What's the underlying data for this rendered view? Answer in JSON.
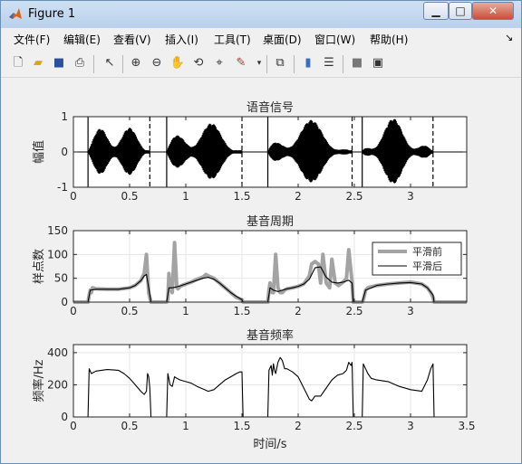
{
  "window": {
    "title": "Figure 1"
  },
  "menu": [
    "文件(F)",
    "编辑(E)",
    "查看(V)",
    "插入(I)",
    "工具(T)",
    "桌面(D)",
    "窗口(W)",
    "帮助(H)"
  ],
  "toolbar": [
    "new-figure",
    "open-file",
    "save",
    "print",
    "edit-pointer",
    "zoom-in",
    "zoom-out",
    "pan",
    "rotate-3d",
    "data-cursor",
    "brush",
    "link-plot",
    "colorbar",
    "legend",
    "hide-plot-tools",
    "show-plot-tools"
  ],
  "chart_data": [
    {
      "type": "line",
      "title": "语音信号",
      "ylabel": "幅值",
      "xlabel": "",
      "xlim": [
        0,
        3.5
      ],
      "ylim": [
        -1,
        1
      ],
      "xticks": [
        "0",
        "0.5",
        "1",
        "1.5",
        "2",
        "2.5",
        "3"
      ],
      "yticks": [
        "-1",
        "0",
        "1"
      ],
      "segments": [
        {
          "start": 0.13,
          "end": 0.68
        },
        {
          "start": 0.83,
          "end": 1.5
        },
        {
          "start": 1.73,
          "end": 2.48
        },
        {
          "start": 2.57,
          "end": 3.2
        }
      ],
      "solid_markers": [
        0.13,
        0.83,
        1.73,
        2.57
      ],
      "dashed_markers": [
        0.68,
        1.5,
        2.48,
        3.2
      ]
    },
    {
      "type": "line",
      "title": "基音周期",
      "ylabel": "样点数",
      "xlabel": "",
      "xlim": [
        0,
        3.5
      ],
      "ylim": [
        0,
        150
      ],
      "xticks": [
        "0",
        "0.5",
        "1",
        "1.5",
        "2",
        "2.5",
        "3"
      ],
      "yticks": [
        "0",
        "50",
        "100",
        "150"
      ],
      "legend": [
        "平滑前",
        "平滑后"
      ],
      "legend_position": "right",
      "series": [
        {
          "name": "平滑前",
          "x": [
            0,
            0.13,
            0.14,
            0.15,
            0.16,
            0.17,
            0.2,
            0.3,
            0.4,
            0.5,
            0.55,
            0.6,
            0.63,
            0.65,
            0.66,
            0.67,
            0.68,
            0.69,
            0.83,
            0.84,
            0.85,
            0.86,
            0.88,
            0.9,
            0.92,
            0.93,
            0.95,
            0.98,
            1.0,
            1.05,
            1.1,
            1.15,
            1.18,
            1.2,
            1.25,
            1.3,
            1.35,
            1.4,
            1.45,
            1.5,
            1.51,
            1.73,
            1.74,
            1.75,
            1.76,
            1.77,
            1.78,
            1.8,
            1.82,
            1.84,
            1.86,
            1.88,
            1.9,
            1.95,
            2.0,
            2.05,
            2.1,
            2.12,
            2.15,
            2.18,
            2.2,
            2.22,
            2.25,
            2.28,
            2.3,
            2.33,
            2.36,
            2.4,
            2.43,
            2.45,
            2.48,
            2.49,
            2.57,
            2.58,
            2.6,
            2.62,
            2.65,
            2.7,
            2.8,
            2.9,
            3.0,
            3.1,
            3.15,
            3.18,
            3.2,
            3.21,
            3.5
          ],
          "y": [
            0,
            0,
            15,
            25,
            20,
            30,
            28,
            27,
            27,
            30,
            35,
            45,
            60,
            100,
            60,
            20,
            10,
            0,
            0,
            5,
            60,
            30,
            20,
            125,
            30,
            28,
            33,
            36,
            38,
            42,
            48,
            52,
            58,
            55,
            50,
            40,
            30,
            20,
            10,
            5,
            0,
            0,
            25,
            40,
            30,
            20,
            20,
            100,
            30,
            20,
            20,
            25,
            28,
            30,
            33,
            38,
            55,
            80,
            85,
            80,
            40,
            100,
            40,
            30,
            90,
            40,
            35,
            42,
            50,
            110,
            42,
            0,
            0,
            5,
            25,
            30,
            32,
            35,
            38,
            40,
            42,
            38,
            30,
            20,
            10,
            0,
            0
          ]
        },
        {
          "name": "平滑后",
          "x": [
            0,
            0.13,
            0.15,
            0.2,
            0.3,
            0.4,
            0.5,
            0.55,
            0.6,
            0.63,
            0.65,
            0.67,
            0.69,
            0.83,
            0.85,
            0.88,
            0.92,
            0.95,
            1.0,
            1.05,
            1.1,
            1.15,
            1.2,
            1.25,
            1.3,
            1.35,
            1.4,
            1.45,
            1.5,
            1.51,
            1.73,
            1.75,
            1.78,
            1.82,
            1.86,
            1.9,
            1.95,
            2.0,
            2.05,
            2.1,
            2.15,
            2.2,
            2.25,
            2.3,
            2.35,
            2.4,
            2.45,
            2.48,
            2.49,
            2.57,
            2.6,
            2.65,
            2.7,
            2.8,
            2.9,
            3.0,
            3.1,
            3.15,
            3.2,
            3.21,
            3.5
          ],
          "y": [
            0,
            0,
            25,
            27,
            27,
            27,
            30,
            35,
            45,
            55,
            58,
            30,
            0,
            0,
            30,
            30,
            32,
            34,
            38,
            42,
            46,
            50,
            52,
            48,
            40,
            30,
            20,
            12,
            5,
            0,
            0,
            30,
            25,
            22,
            25,
            28,
            30,
            33,
            38,
            48,
            72,
            74,
            52,
            42,
            40,
            42,
            46,
            40,
            0,
            0,
            25,
            30,
            35,
            38,
            40,
            41,
            38,
            30,
            15,
            0,
            0
          ]
        }
      ]
    },
    {
      "type": "line",
      "title": "基音频率",
      "ylabel": "频率/Hz",
      "xlabel": "时间/s",
      "xlim": [
        0,
        3.5
      ],
      "ylim": [
        0,
        450
      ],
      "xticks": [
        "0",
        "0.5",
        "1",
        "1.5",
        "2",
        "2.5",
        "3",
        "3.5"
      ],
      "yticks": [
        "0",
        "200",
        "400"
      ],
      "series": [
        {
          "name": "",
          "x": [
            0,
            0.13,
            0.14,
            0.16,
            0.2,
            0.3,
            0.4,
            0.45,
            0.5,
            0.55,
            0.6,
            0.63,
            0.65,
            0.66,
            0.67,
            0.68,
            0.69,
            0.83,
            0.84,
            0.86,
            0.88,
            0.9,
            0.92,
            0.95,
            1.0,
            1.05,
            1.1,
            1.15,
            1.2,
            1.25,
            1.3,
            1.35,
            1.4,
            1.45,
            1.48,
            1.5,
            1.51,
            1.73,
            1.74,
            1.76,
            1.77,
            1.78,
            1.79,
            1.8,
            1.82,
            1.84,
            1.86,
            1.88,
            1.9,
            1.95,
            2.0,
            2.05,
            2.1,
            2.12,
            2.15,
            2.2,
            2.25,
            2.3,
            2.35,
            2.4,
            2.43,
            2.45,
            2.47,
            2.48,
            2.49,
            2.57,
            2.58,
            2.6,
            2.62,
            2.65,
            2.7,
            2.8,
            2.9,
            3.0,
            3.1,
            3.15,
            3.18,
            3.2,
            3.21,
            3.5
          ],
          "y": [
            0,
            0,
            300,
            270,
            285,
            295,
            290,
            270,
            240,
            200,
            160,
            140,
            160,
            270,
            250,
            180,
            0,
            0,
            270,
            200,
            190,
            250,
            240,
            230,
            220,
            210,
            190,
            175,
            160,
            170,
            200,
            230,
            250,
            270,
            280,
            280,
            0,
            0,
            290,
            320,
            260,
            330,
            290,
            270,
            340,
            370,
            350,
            300,
            300,
            280,
            250,
            180,
            110,
            100,
            130,
            130,
            180,
            230,
            260,
            270,
            290,
            340,
            320,
            340,
            0,
            0,
            330,
            300,
            270,
            240,
            230,
            220,
            190,
            170,
            160,
            230,
            300,
            330,
            0,
            0
          ]
        }
      ]
    }
  ]
}
